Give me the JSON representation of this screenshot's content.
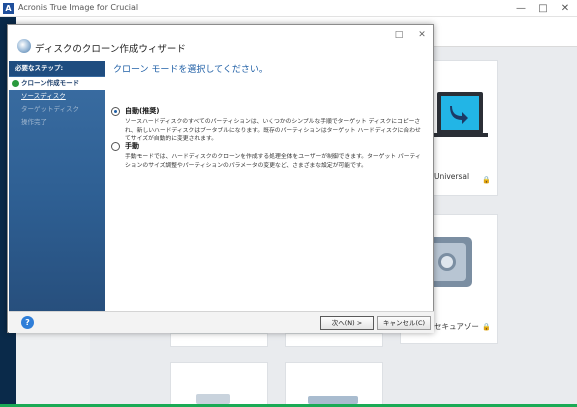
{
  "app": {
    "title": "Acronis True Image for Crucial",
    "logo_letter": "A",
    "window_controls": [
      "—",
      "□",
      "✕"
    ],
    "cards": [
      {
        "label": "Universal"
      },
      {
        "label": "セキュアゾー"
      }
    ]
  },
  "dialog": {
    "title": "ディスクのクローン作成ウィザード",
    "window_controls": [
      "□",
      "✕"
    ],
    "steps_header": "必要なステップ:",
    "steps": [
      {
        "label": "クローン作成モード",
        "state": "active"
      },
      {
        "label": "ソースディスク",
        "state": "link"
      },
      {
        "label": "ターゲットディスク",
        "state": "disabled"
      },
      {
        "label": "操作完了",
        "state": "disabled"
      }
    ],
    "page_title": "クローン モードを選択してください。",
    "options": [
      {
        "label": "自動(推奨)",
        "selected": true,
        "description": "ソースハードディスクのすべてのパーティションは、いくつかのシンプルな手順でターゲット ディスクにコピーされ、新しいハードディスクはブータブルになります。既存のパーティションはターゲット ハードディスクに合わせてサイズが自動的に変更されます。"
      },
      {
        "label": "手動",
        "selected": false,
        "description": "手動モードでは、ハードディスクのクローンを作成する処理全体をユーザーが制御できます。ターゲット パーティションのサイズ調整やパーティションのパラメータの変更など、さまざまな設定が可能です。"
      }
    ],
    "help_label": "?",
    "next_button": "次へ(N) >",
    "cancel_button": "キャンセル(C)"
  },
  "colors": {
    "accent": "#1f5fa6",
    "sidebar": "#2e5f93",
    "app_sidebar": "#0a2a4a",
    "status_line": "#1aaa55"
  }
}
